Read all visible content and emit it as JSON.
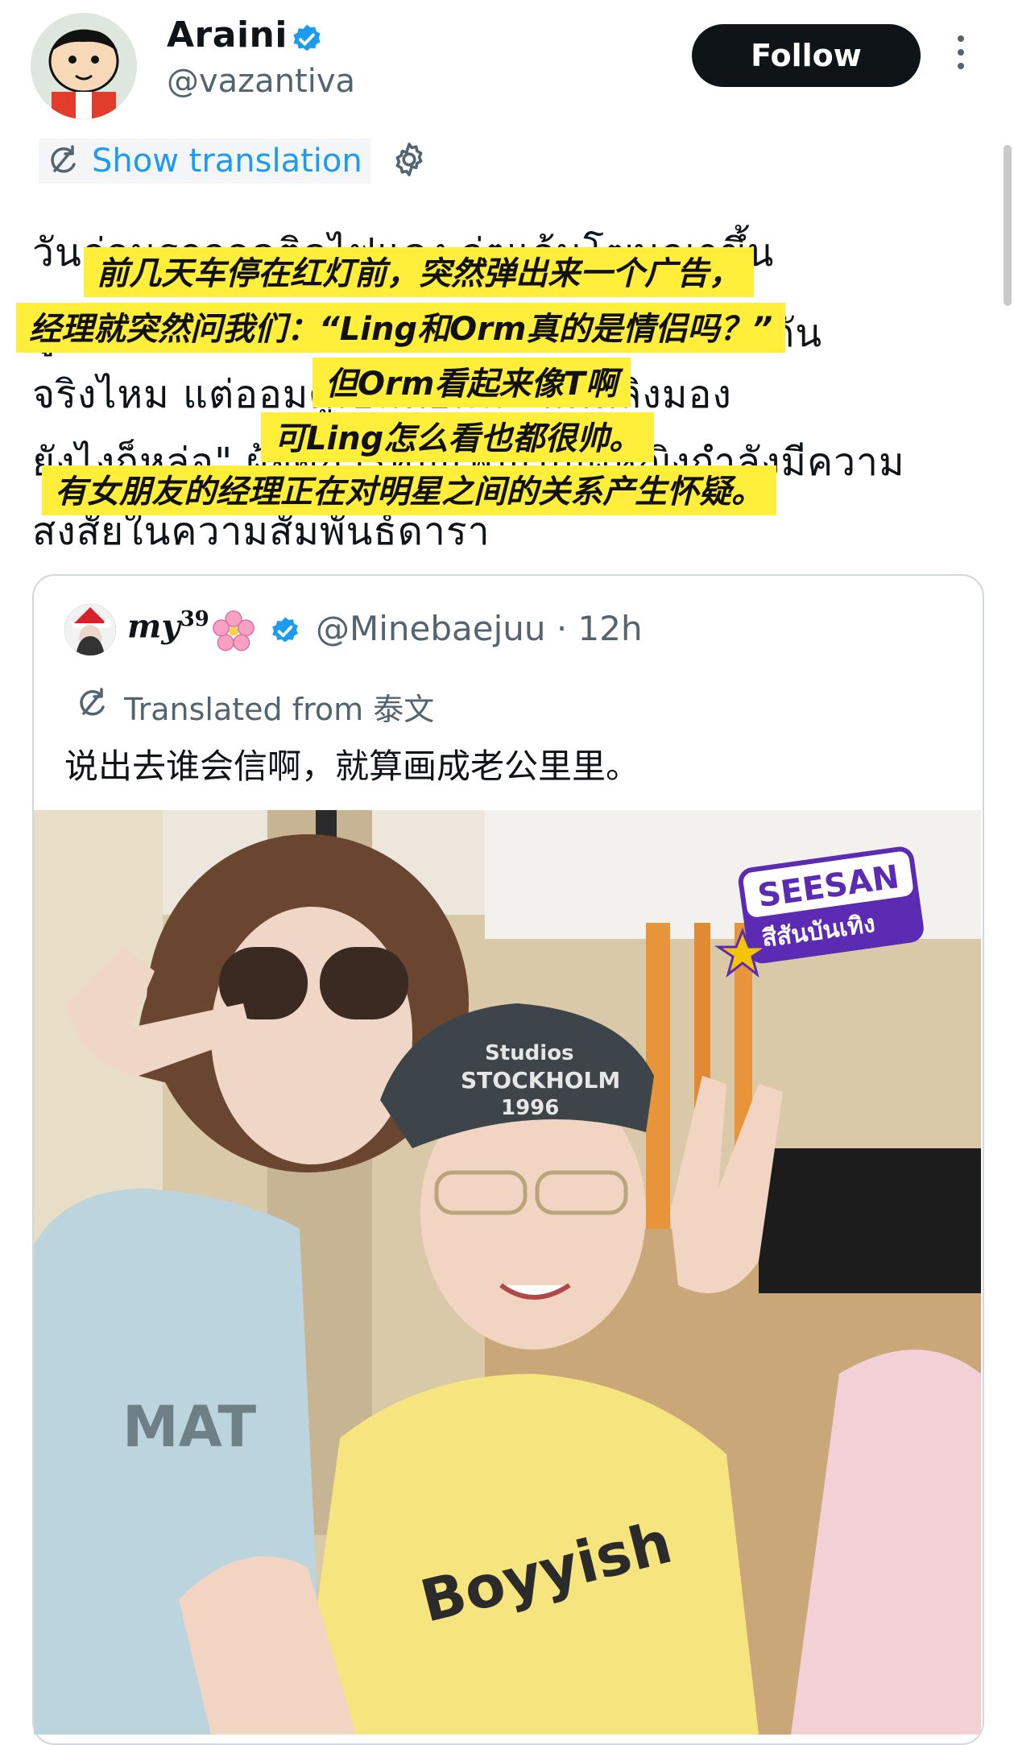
{
  "author": {
    "name": "Araini",
    "handle": "@vazantiva",
    "follow_label": "Follow"
  },
  "translation": {
    "label": "Show translation"
  },
  "tweet_lines": [
    "วันก่อนรถจอดติดไฟแดง จู่ๆแอ้นโฆษณาขึ้น",
    "ผู้จัดการก็ถามพวกเราว่า \"หลิงออมเป็นแฟนกัน",
    "จริงไหม แต่ออมดูเป็นทอมนะ แต่หลิงมอง",
    "ยังไงก็หล่อ\" ผู้จัดการที่มีแฟนเป็นผู้หญิงกำลังมีความ",
    "สงสัยในความสัมพันธ์ดารา"
  ],
  "captions": [
    "前几天车停在红灯前，突然弹出来一个广告，",
    "经理就突然问我们：“Ling和Orm真的是情侣吗？”",
    "但Orm看起来像T啊",
    "可Ling怎么看也都很帅。",
    "有女朋友的经理正在对明星之间的关系产生怀疑。"
  ],
  "quote": {
    "name": "my",
    "name_sup": "39",
    "handle_time": "@Minebaejuu · 12h",
    "translated_from": "Translated from 泰文",
    "text": "说出去谁会信啊，就算画成老公里里。",
    "image": {
      "sticker_title": "SEESAN",
      "sticker_subtitle": "สีสันบันเทิง",
      "cap_text_1": "Studios",
      "cap_text_2": "STOCKHOLM",
      "cap_text_3": "1996",
      "shirt_left_text": "MAT",
      "shirt_right_text": "Boyyish"
    }
  },
  "colors": {
    "accent": "#1d9bf0",
    "caption_bg": "#ffef3a",
    "follow_bg": "#0f1419"
  }
}
